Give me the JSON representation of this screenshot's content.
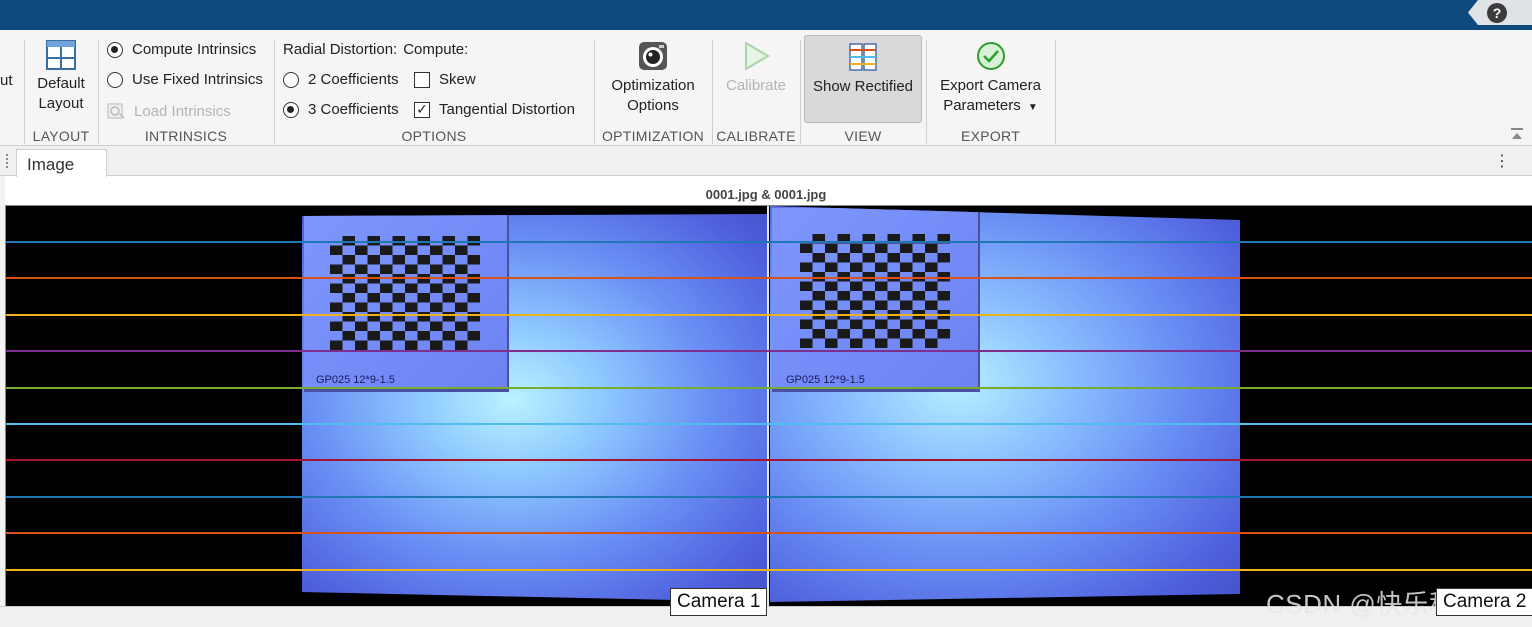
{
  "ribbon": {
    "partial_label": "ut",
    "layout": {
      "button_line1": "Default",
      "button_line2": "Layout",
      "section": "LAYOUT"
    },
    "intrinsics": {
      "option1": "Compute Intrinsics",
      "option2": "Use Fixed Intrinsics",
      "load": "Load Intrinsics",
      "section": "INTRINSICS"
    },
    "options": {
      "radial_label": "Radial Distortion:",
      "compute_label": "Compute:",
      "coef2": "2 Coefficients",
      "coef3": "3 Coefficients",
      "skew": "Skew",
      "tangential": "Tangential Distortion",
      "section": "OPTIONS"
    },
    "optimization": {
      "button_line1": "Optimization",
      "button_line2": "Options",
      "section": "OPTIMIZATION"
    },
    "calibrate": {
      "button": "Calibrate",
      "section": "CALIBRATE"
    },
    "view": {
      "button": "Show Rectified",
      "section": "VIEW"
    },
    "export": {
      "button_line1": "Export Camera",
      "button_line2": "Parameters",
      "section": "EXPORT"
    }
  },
  "tabs": {
    "image_tab": "Image"
  },
  "figure": {
    "title": "0001.jpg & 0001.jpg",
    "board_text_left": "GP025 12*9-1.5",
    "board_text_right": "GP025 12*9-1.5",
    "camera1_label": "Camera 1",
    "camera2_label": "Camera 2"
  },
  "watermark": "CSDN @快乐科研汉",
  "colors": {
    "title_bar": "#0e4a7e",
    "epipolar_lines": [
      "#1f77b4",
      "#d95319",
      "#edb120",
      "#7e2f8e",
      "#77ac30",
      "#4dbeee",
      "#a2142f",
      "#1f77b4",
      "#d95319",
      "#edb120"
    ]
  },
  "icons": {
    "help": "help-icon",
    "layout": "grid-layout-icon",
    "load": "load-intrinsics-icon",
    "optimization": "camera-lens-icon",
    "calibrate": "play-icon",
    "view": "rectified-view-icon",
    "export": "check-circle-icon",
    "collapse": "collapse-ribbon-icon",
    "menu": "kebab-menu-icon"
  }
}
